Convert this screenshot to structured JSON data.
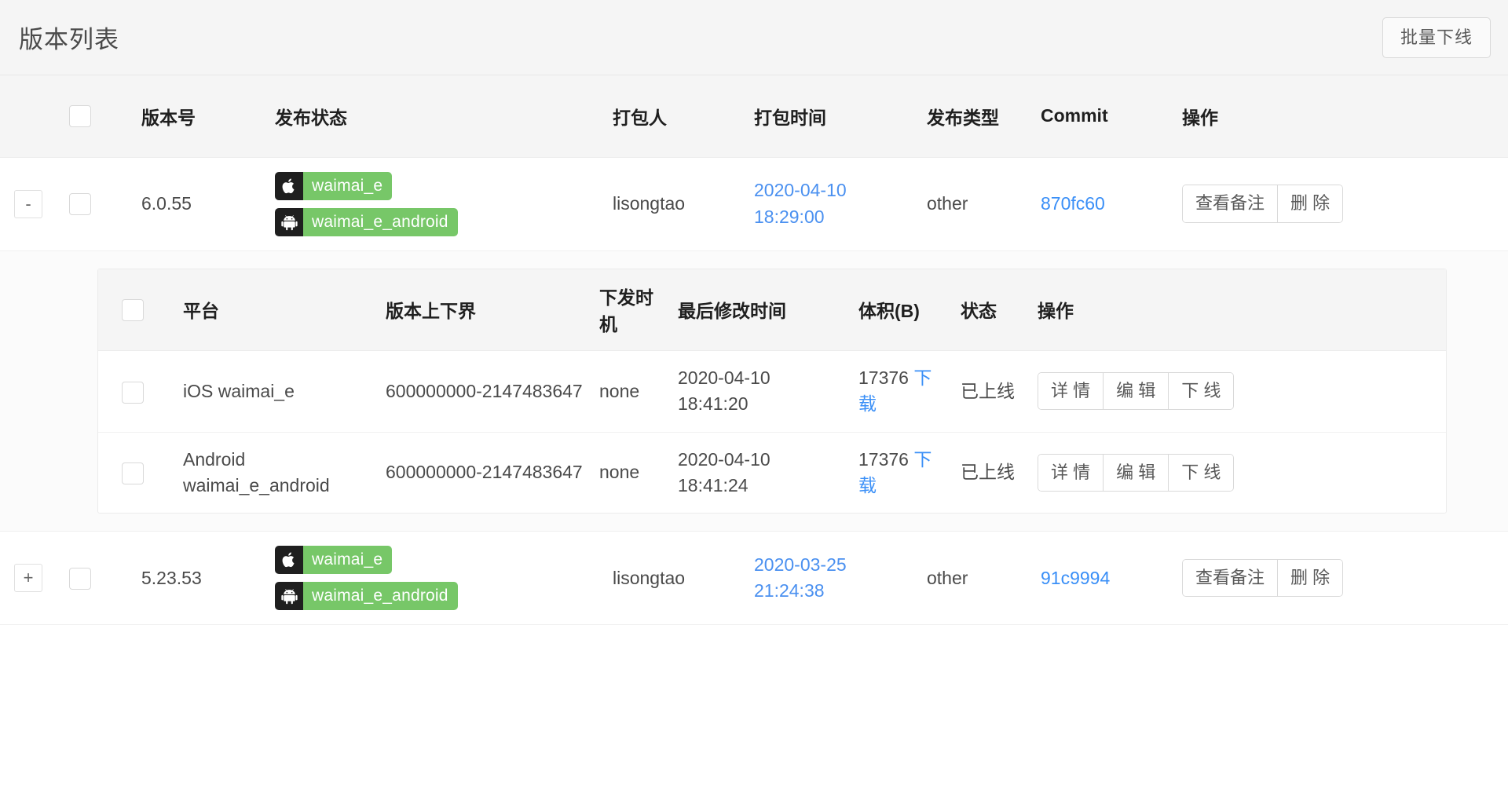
{
  "header": {
    "title": "版本列表",
    "batch_offline_label": "批量下线"
  },
  "colors": {
    "accent_link": "#4a90f0",
    "badge_green": "#77c768",
    "badge_icon_bg": "#1f1f1f",
    "header_bg": "#f5f5f5",
    "border": "#e8e8e8"
  },
  "table": {
    "columns": [
      {
        "key": "expand",
        "label": ""
      },
      {
        "key": "select",
        "label": ""
      },
      {
        "key": "version",
        "label": "版本号"
      },
      {
        "key": "release_status",
        "label": "发布状态"
      },
      {
        "key": "packager",
        "label": "打包人"
      },
      {
        "key": "pack_time",
        "label": "打包时间"
      },
      {
        "key": "release_type",
        "label": "发布类型"
      },
      {
        "key": "commit",
        "label": "Commit"
      },
      {
        "key": "operation",
        "label": "操作"
      }
    ],
    "select_all_checkbox": {
      "checked": false
    },
    "rows": [
      {
        "expander": "-",
        "expanded": true,
        "checkbox": {
          "checked": false
        },
        "version": "6.0.55",
        "badges": [
          {
            "icon": "apple-icon",
            "label": "waimai_e"
          },
          {
            "icon": "android-icon",
            "label": "waimai_e_android"
          }
        ],
        "packager": "lisongtao",
        "pack_time": "2020-04-10 18:29:00",
        "release_type": "other",
        "commit": "870fc60",
        "actions": [
          "查看备注",
          "删 除"
        ],
        "sub_table": {
          "columns": [
            {
              "key": "select",
              "label": ""
            },
            {
              "key": "platform",
              "label": "平台"
            },
            {
              "key": "version_range",
              "label": "版本上下界"
            },
            {
              "key": "timing",
              "label": "下发时机"
            },
            {
              "key": "last_modified",
              "label": "最后修改时间"
            },
            {
              "key": "size",
              "label": "体积(B)"
            },
            {
              "key": "state",
              "label": "状态"
            },
            {
              "key": "operation",
              "label": "操作"
            }
          ],
          "select_all_checkbox": {
            "checked": false
          },
          "rows": [
            {
              "checkbox": {
                "checked": false
              },
              "platform": "iOS waimai_e",
              "version_range": "600000000-2147483647",
              "timing": "none",
              "last_modified": "2020-04-10 18:41:20",
              "size": "17376",
              "download_label": "下载",
              "state": "已上线",
              "actions": [
                "详 情",
                "编 辑",
                "下 线"
              ]
            },
            {
              "checkbox": {
                "checked": false
              },
              "platform": "Android waimai_e_android",
              "version_range": "600000000-2147483647",
              "timing": "none",
              "last_modified": "2020-04-10 18:41:24",
              "size": "17376",
              "download_label": "下载",
              "state": "已上线",
              "actions": [
                "详 情",
                "编 辑",
                "下 线"
              ]
            }
          ]
        }
      },
      {
        "expander": "+",
        "expanded": false,
        "checkbox": {
          "checked": false
        },
        "version": "5.23.53",
        "badges": [
          {
            "icon": "apple-icon",
            "label": "waimai_e"
          },
          {
            "icon": "android-icon",
            "label": "waimai_e_android"
          }
        ],
        "packager": "lisongtao",
        "pack_time": "2020-03-25 21:24:38",
        "release_type": "other",
        "commit": "91c9994",
        "actions": [
          "查看备注",
          "删 除"
        ]
      }
    ]
  }
}
